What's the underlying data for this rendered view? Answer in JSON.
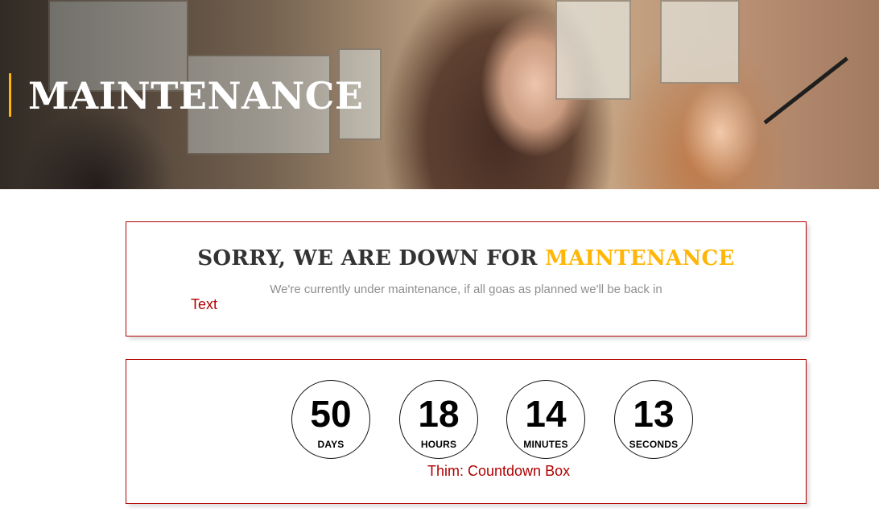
{
  "hero": {
    "title": "MAINTENANCE",
    "accent_color": "#ffb606"
  },
  "message_widget": {
    "heading_prefix": "SORRY, WE ARE DOWN FOR ",
    "heading_highlight": "MAINTENANCE",
    "subtext": "We're currently under maintenance, if all goas as planned we'll be back in",
    "widget_label": "Text",
    "highlight_color": "#ffb606"
  },
  "countdown_widget": {
    "widget_label": "Thim: Countdown Box",
    "units": [
      {
        "value": "50",
        "label": "DAYS"
      },
      {
        "value": "18",
        "label": "HOURS"
      },
      {
        "value": "14",
        "label": "MINUTES"
      },
      {
        "value": "13",
        "label": "SECONDS"
      }
    ]
  }
}
